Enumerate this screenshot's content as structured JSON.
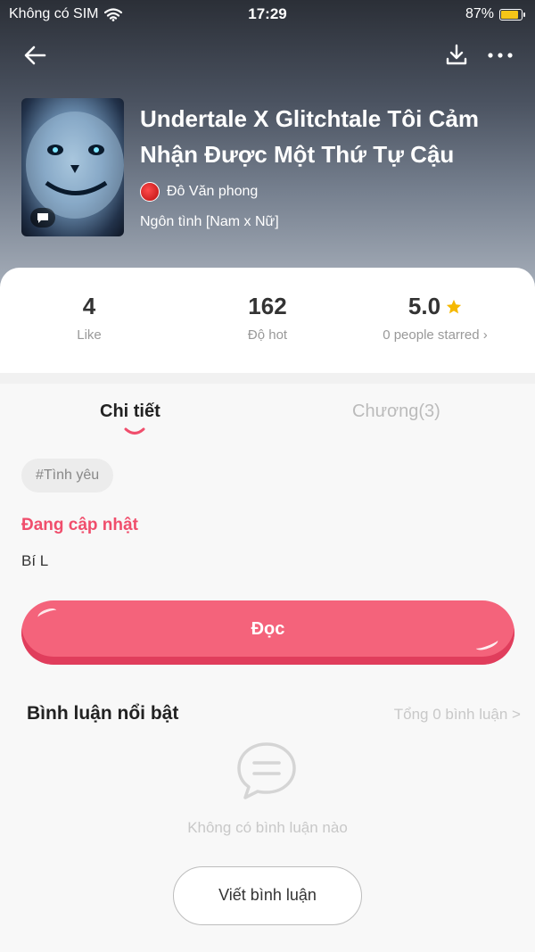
{
  "status_bar": {
    "carrier": "Không có SIM",
    "time": "17:29",
    "battery": "87%",
    "battery_level": 0.87,
    "battery_color": "#f5c518"
  },
  "nav": {
    "back_icon": "arrow-left-icon",
    "download_icon": "download-icon",
    "more_icon": "more-icon"
  },
  "book": {
    "title": "Undertale X Glitchtale Tôi Cảm Nhận Được Một Thứ Tự Cậu",
    "author": "Đô Văn phong",
    "genre": "Ngôn tình [Nam x Nữ]"
  },
  "stats": [
    {
      "value": "4",
      "label": "Like"
    },
    {
      "value": "162",
      "label": "Độ hot"
    },
    {
      "value": "5.0",
      "label": "0 people starred ›"
    }
  ],
  "tabs": {
    "details": "Chi tiết",
    "chapters": "Chương(3)"
  },
  "detail": {
    "tag": "#Tình yêu",
    "status": "Đang cập nhật",
    "description": "Bí L"
  },
  "read_button": "Đọc",
  "comments": {
    "title": "Bình luận nổi bật",
    "total": "Tổng 0 bình luận >",
    "empty": "Không có bình luận nào",
    "write": "Viết bình luận"
  },
  "colors": {
    "accent": "#f4637b",
    "accent_text": "#f04e6c",
    "star": "#f5b800"
  }
}
